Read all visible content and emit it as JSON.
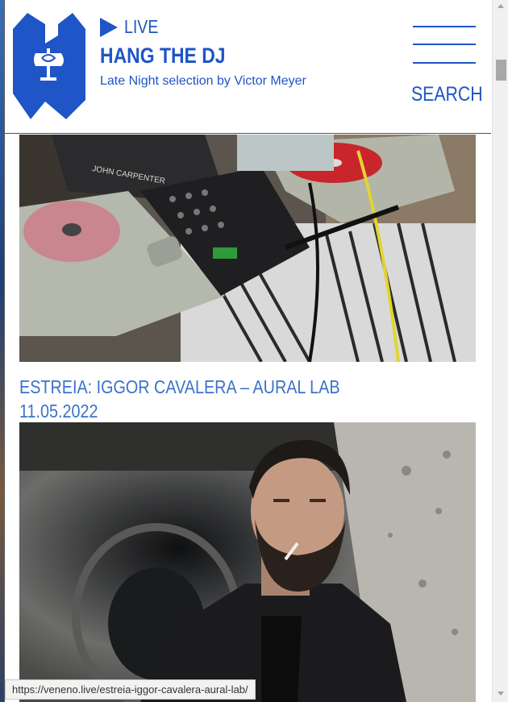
{
  "header": {
    "live_label": "LIVE",
    "show_title": "HANG THE DJ",
    "show_subtitle": "Late Night selection by Victor Meyer",
    "search_label": "SEARCH"
  },
  "posts": [
    {
      "image_alt": "DJ setup with turntables and mixer"
    },
    {
      "title": "ESTREIA: IGGOR CAVALERA – AURAL LAB",
      "date": "11.05.2022",
      "image_alt": "Portrait of bearded man in leather jacket smoking in tunnel"
    }
  ],
  "status_bar": {
    "url": "https://veneno.live/estreia-iggor-cavalera-aural-lab/"
  },
  "colors": {
    "brand_blue": "#1f55c7",
    "link_blue": "#3a72c9"
  },
  "icons": [
    "play-icon",
    "menu-icon",
    "logo"
  ]
}
